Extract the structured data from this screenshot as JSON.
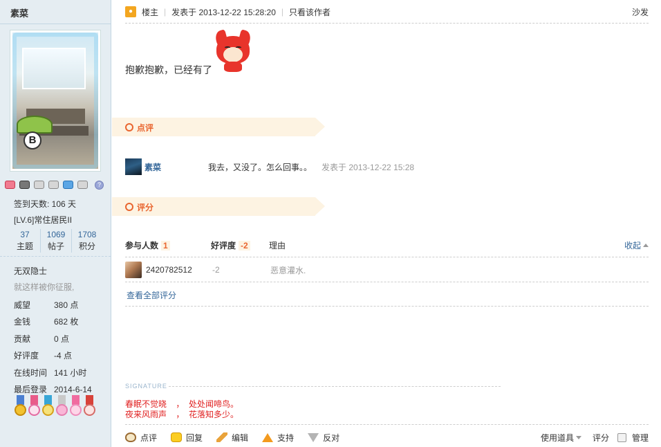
{
  "author": {
    "name": "素菜",
    "checkin": "签到天数: 106 天",
    "level": "[LV.6]常住居民II",
    "stats": [
      {
        "num": "37",
        "label": "主题"
      },
      {
        "num": "1069",
        "label": "帖子"
      },
      {
        "num": "1708",
        "label": "积分"
      }
    ],
    "group_title": "无双隐士",
    "motto": "就这样被你征服,",
    "props": [
      {
        "key": "威望",
        "value": "380 点"
      },
      {
        "key": "金钱",
        "value": "682 枚"
      },
      {
        "key": "贡献",
        "value": "0 点"
      },
      {
        "key": "好评度",
        "value": "-4 点"
      },
      {
        "key": "在线时间",
        "value": "141 小时"
      },
      {
        "key": "最后登录",
        "value": "2014-6-14"
      }
    ],
    "help_badge": "?"
  },
  "post": {
    "op_label": "楼主",
    "time": "发表于 2013-12-22 15:28:20",
    "only_author": "只看该作者",
    "floor": "沙发",
    "content": "抱歉抱歉，已经有了"
  },
  "comments": {
    "tab_label": "点评",
    "items": [
      {
        "user": "素菜",
        "text": "我去，又没了。怎么回事。。",
        "time": "发表于 2013-12-22 15:28"
      }
    ]
  },
  "rating": {
    "tab_label": "评分",
    "col_participants": "参与人数",
    "participants_count": "1",
    "col_score": "好评度",
    "score_total": "-2",
    "col_reason": "理由",
    "collapse": "收起",
    "rows": [
      {
        "user": "2420782512",
        "score": "-2",
        "reason": "恶意灌水."
      }
    ],
    "view_all": "查看全部评分"
  },
  "signature": {
    "label": "SIGNATURE",
    "lines": [
      "春眠不觉晓    ，  处处闻啼鸟。",
      "夜来风雨声    ，  花落知多少。"
    ]
  },
  "actions": {
    "comment": "点评",
    "reply": "回复",
    "edit": "编辑",
    "support": "支持",
    "oppose": "反对",
    "tools": "使用道具",
    "rate": "评分",
    "manage": "管理"
  },
  "colors": {
    "link": "#336699",
    "accent": "#e9652f",
    "signature": "#e02020",
    "sidebar_bg": "#e5edf2"
  }
}
